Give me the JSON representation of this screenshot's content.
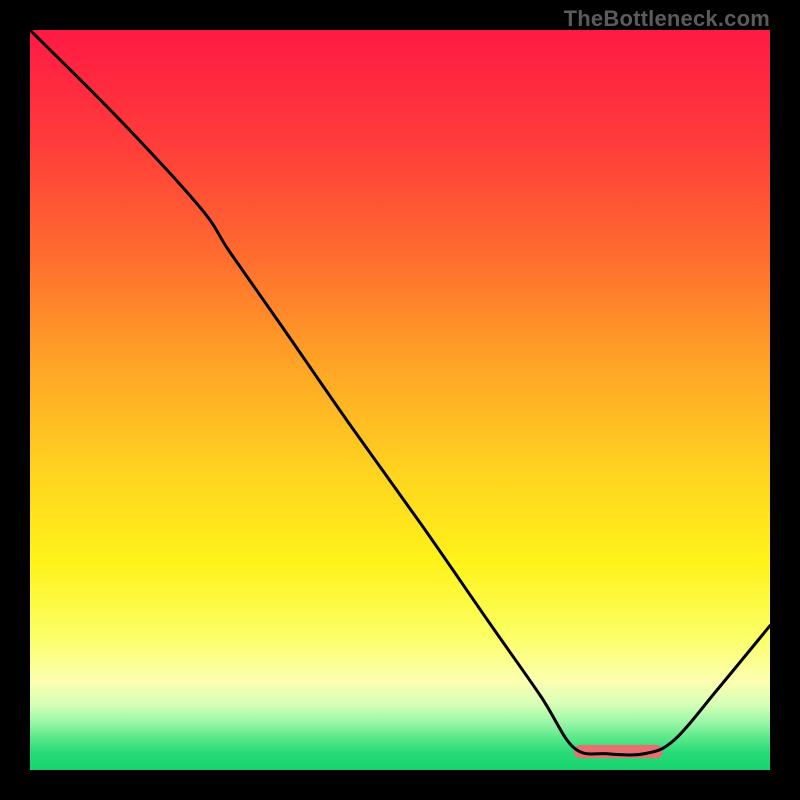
{
  "watermark": "TheBottleneck.com",
  "gradient_stops": [
    {
      "offset": 0.0,
      "color": "#ff1a44"
    },
    {
      "offset": 0.15,
      "color": "#ff3b3b"
    },
    {
      "offset": 0.3,
      "color": "#ff6a2f"
    },
    {
      "offset": 0.45,
      "color": "#ffa326"
    },
    {
      "offset": 0.6,
      "color": "#ffd41f"
    },
    {
      "offset": 0.72,
      "color": "#fff31a"
    },
    {
      "offset": 0.82,
      "color": "#fcff66"
    },
    {
      "offset": 0.88,
      "color": "#fcffb0"
    },
    {
      "offset": 0.91,
      "color": "#d8ffb8"
    },
    {
      "offset": 0.935,
      "color": "#9cf7a8"
    },
    {
      "offset": 0.955,
      "color": "#5fe98c"
    },
    {
      "offset": 0.975,
      "color": "#2bdc78"
    },
    {
      "offset": 1.0,
      "color": "#17d36e"
    }
  ],
  "marker": {
    "color": "#e87070",
    "x0": 0.735,
    "x1": 0.855,
    "y": 0.975,
    "thickness_frac": 0.018,
    "rx_frac": 0.009
  },
  "chart_data": {
    "type": "line",
    "title": "",
    "xlabel": "",
    "ylabel": "",
    "xlim": [
      0,
      1
    ],
    "ylim": [
      0,
      1
    ],
    "grid": false,
    "series": [
      {
        "name": "curve",
        "points": [
          {
            "x": 0.0,
            "y": 1.0
          },
          {
            "x": 0.12,
            "y": 0.88
          },
          {
            "x": 0.23,
            "y": 0.76
          },
          {
            "x": 0.27,
            "y": 0.7
          },
          {
            "x": 0.34,
            "y": 0.6
          },
          {
            "x": 0.43,
            "y": 0.47
          },
          {
            "x": 0.53,
            "y": 0.33
          },
          {
            "x": 0.62,
            "y": 0.2
          },
          {
            "x": 0.69,
            "y": 0.1
          },
          {
            "x": 0.735,
            "y": 0.03
          },
          {
            "x": 0.78,
            "y": 0.022
          },
          {
            "x": 0.83,
            "y": 0.022
          },
          {
            "x": 0.87,
            "y": 0.04
          },
          {
            "x": 0.93,
            "y": 0.11
          },
          {
            "x": 1.0,
            "y": 0.195
          }
        ]
      }
    ],
    "marker_range_x": [
      0.735,
      0.855
    ]
  }
}
